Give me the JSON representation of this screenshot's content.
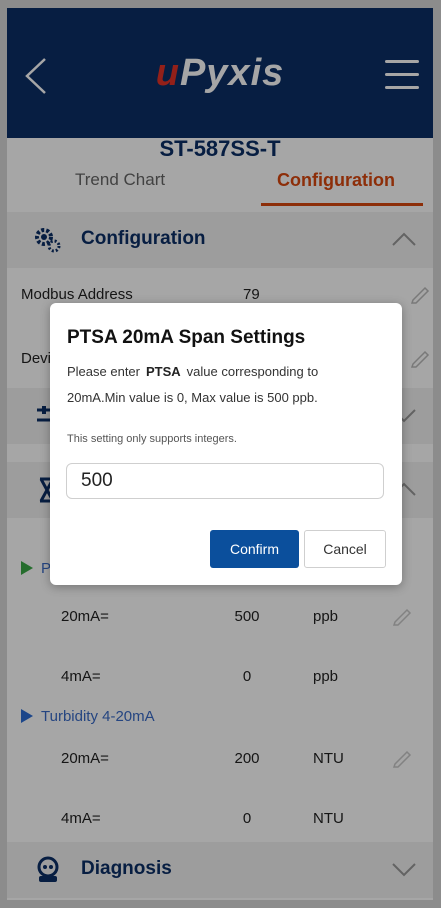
{
  "header": {
    "logo_u": "u",
    "logo_rest": "Pyxis"
  },
  "device": {
    "title": "ST-587SS-T"
  },
  "tabs": [
    {
      "label": "Trend Chart",
      "active": false
    },
    {
      "label": "Configuration",
      "active": true
    }
  ],
  "sections": {
    "configuration": {
      "title": "Configuration"
    },
    "diagnosis": {
      "title": "Diagnosis"
    }
  },
  "config_rows": [
    {
      "label": "Modbus Address",
      "value": "79"
    },
    {
      "label": "Devi",
      "value": ""
    }
  ],
  "groups": [
    {
      "label": "P",
      "rows": [
        {
          "key": "20mA=",
          "value": "500",
          "unit": "ppb"
        },
        {
          "key": "4mA=",
          "value": "0",
          "unit": "ppb"
        }
      ]
    },
    {
      "label": "Turbidity 4-20mA",
      "rows": [
        {
          "key": "20mA=",
          "value": "200",
          "unit": "NTU"
        },
        {
          "key": "4mA=",
          "value": "0",
          "unit": "NTU"
        }
      ]
    }
  ],
  "dialog": {
    "title": "PTSA 20mA Span Settings",
    "prompt_before": "Please enter",
    "prompt_param": "PTSA",
    "prompt_after": "value corresponding to",
    "line2": "20mA.Min value is 0, Max value is 500 ppb.",
    "note": "This setting only supports integers.",
    "input_value": "500",
    "confirm_label": "Confirm",
    "cancel_label": "Cancel"
  },
  "colors": {
    "header_bg": "#0b2e66",
    "accent": "#d9480f",
    "primary_button": "#0b4f9c",
    "link_blue": "#3a6bc6"
  }
}
